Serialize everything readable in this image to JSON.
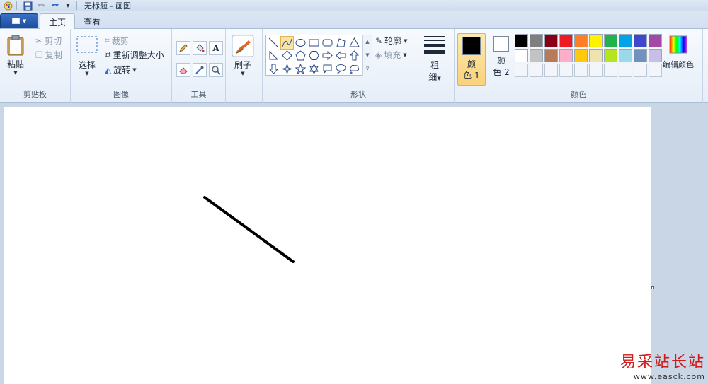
{
  "window": {
    "title": "无标题 - 画图"
  },
  "tabs": [
    {
      "label": "主页",
      "active": true
    },
    {
      "label": "查看",
      "active": false
    }
  ],
  "clipboard": {
    "paste": "粘贴",
    "cut": "剪切",
    "copy": "复制",
    "group": "剪贴板"
  },
  "image": {
    "select": "选择",
    "crop": "裁剪",
    "resize": "重新调整大小",
    "rotate": "旋转",
    "group": "图像"
  },
  "tools": {
    "group": "工具",
    "items": [
      "pencil-icon",
      "fill-bucket-icon",
      "text-icon",
      "eraser-icon",
      "color-picker-icon",
      "magnifier-icon"
    ]
  },
  "brushes": {
    "label": "刷子"
  },
  "shapes": {
    "group": "形状",
    "outline": "轮廓",
    "fill": "填充",
    "selected": "curve"
  },
  "size": {
    "label_1": "粗",
    "label_2": "细"
  },
  "colors": {
    "group": "颜色",
    "color1_label_1": "颜",
    "color1_label_2": "色 1",
    "color2_label_1": "颜",
    "color2_label_2": "色 2",
    "color1": "#000000",
    "color2": "#ffffff",
    "edit": "编辑颜色",
    "palette_row1": [
      "#000000",
      "#7f7f7f",
      "#880015",
      "#ed1c24",
      "#ff7f27",
      "#fff200",
      "#22b14c",
      "#00a2e8",
      "#3f48cc",
      "#a349a4"
    ],
    "palette_row2": [
      "#ffffff",
      "#c3c3c3",
      "#b97a57",
      "#ffaec9",
      "#ffc90e",
      "#efe4b0",
      "#b5e61d",
      "#99d9ea",
      "#7092be",
      "#c8bfe7"
    ]
  },
  "watermark": {
    "brand": "易采站长站",
    "url": "www.easck.com"
  }
}
